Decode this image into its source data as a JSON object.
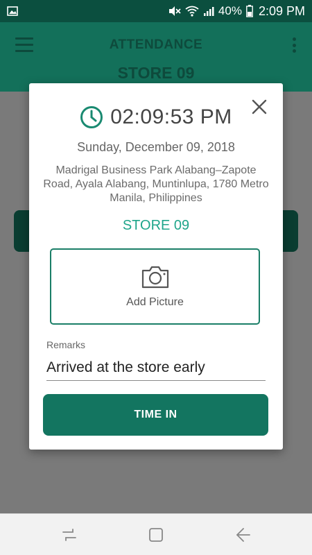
{
  "status_bar": {
    "battery_percent": "40%",
    "time": "2:09 PM",
    "icons": [
      "image-icon",
      "mute-icon",
      "wifi-icon",
      "signal-icon",
      "battery-icon"
    ]
  },
  "app_bar": {
    "title": "ATTENDANCE",
    "subtitle": "STORE 09",
    "icons": [
      "menu-icon",
      "more-vert-icon"
    ]
  },
  "dialog": {
    "time": "02:09:53 PM",
    "date": "Sunday, December 09, 2018",
    "address": "Madrigal Business Park Alabang–Zapote Road, Ayala Alabang, Muntinlupa, 1780 Metro Manila, Philippines",
    "store": "STORE 09",
    "add_picture_label": "Add Picture",
    "remarks_label": "Remarks",
    "remarks_value": "Arrived at the store early",
    "time_in_label": "TIME IN",
    "icons": [
      "clock-icon",
      "close-icon",
      "camera-icon"
    ]
  },
  "nav_bar": {
    "icons": [
      "recent-apps-icon",
      "home-icon",
      "back-icon"
    ]
  },
  "colors": {
    "primary": "#137560",
    "accent": "#1ea58a",
    "status_bar": "#0b4f3f"
  }
}
